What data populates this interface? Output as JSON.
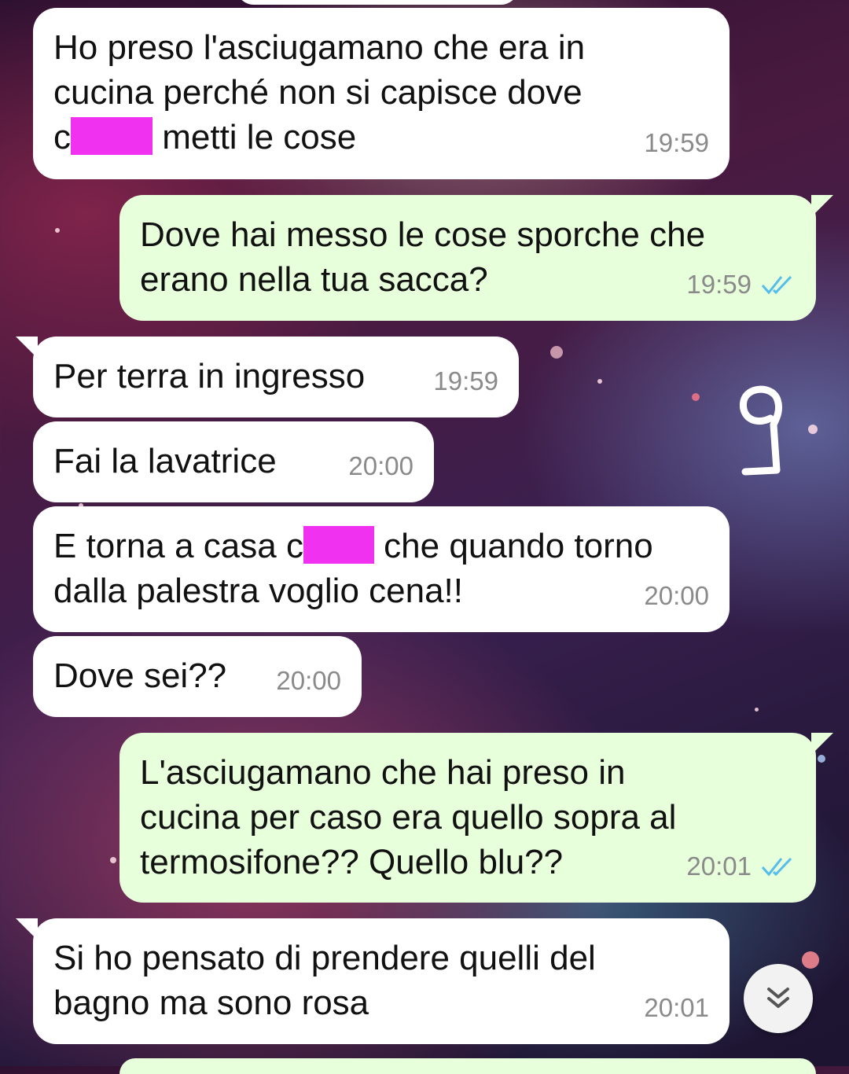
{
  "messages": [
    {
      "lines": [
        "Ho preso l'asciugamano che era in",
        "cucina perché non si capisce dove"
      ],
      "line3_prefix": "c",
      "line3_suffix": " metti le cose",
      "time": "19:59"
    },
    {
      "text": "Dove hai messo le cose sporche che\nerano nella tua sacca?",
      "time": "19:59",
      "status": "read"
    },
    {
      "text": "Per terra in ingresso",
      "time": "19:59"
    },
    {
      "text": "Fai la lavatrice",
      "time": "20:00"
    },
    {
      "line1_prefix": "E torna a casa c",
      "line1_suffix": " che quando torno",
      "line2": "dalla palestra voglio cena!!",
      "time": "20:00"
    },
    {
      "text": "Dove sei??",
      "time": "20:00"
    },
    {
      "text": "L'asciugamano che hai preso in\ncucina per caso era quello sopra al\ntermosifone?? Quello blu??",
      "time": "20:01",
      "status": "read"
    },
    {
      "text": "Si ho pensato di prendere quelli del\nbagno ma sono rosa",
      "time": "20:01"
    }
  ],
  "annotation": "9",
  "colors": {
    "incoming_bubble": "#ffffff",
    "outgoing_bubble": "#e7ffdb",
    "read_ticks": "#53bdeb",
    "redaction": "#f032f0"
  },
  "icons": {
    "read_receipt": "double-check-icon",
    "scroll_down": "double-chevron-down-icon"
  }
}
